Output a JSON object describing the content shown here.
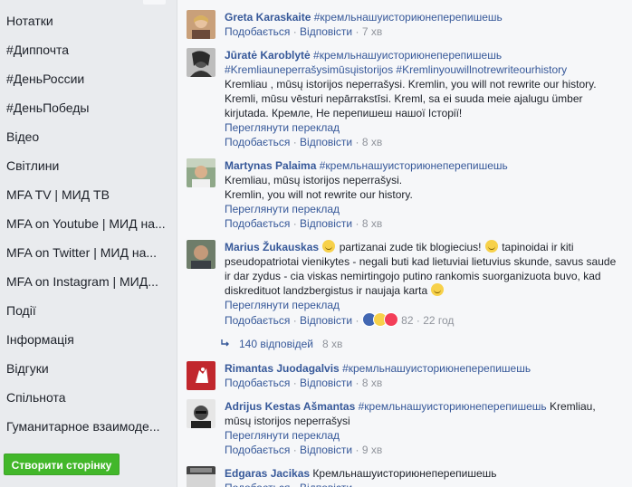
{
  "sidebar": {
    "items": [
      "Нотатки",
      "#Диппочта",
      "#ДеньРоссии",
      "#ДеньПобеды",
      "Відео",
      "Світлини",
      "MFA TV | МИД ТВ",
      "MFA on Youtube | МИД на...",
      "MFA on Twitter | МИД на...",
      "MFA on Instagram | МИД...",
      "Події",
      "Інформація",
      "Відгуки",
      "Спільнота",
      "Гуманитарное взаимоде..."
    ],
    "create_button": "Створити сторінку"
  },
  "actions": {
    "like": "Подобається",
    "reply": "Відповісти",
    "sep": "·",
    "translate": "Переглянути переклад"
  },
  "comments": [
    {
      "author": "Greta Karaskaite",
      "hashtag": "#кремльнашуисториюнеперепишешь",
      "time": "7 хв"
    },
    {
      "author": "Jūratė Karoblytė",
      "hashtag": "#кремльнашуисториюнеперепишешь",
      "hashtags_line2": "#Kremliauneperrašysimūsųistorijos #Kremlinyouwillnotrewriteourhistory",
      "text": "Kremliau , mūsų istorijos neperrašysi. Kremlin, you will not rewrite our history. Kremli, mūsu vēsturi nepārrakstīsi. Kreml, sa ei suuda meie ajalugu ümber kirjutada. Кремле, Не перепишеш нашої Історії!",
      "time": "8 хв"
    },
    {
      "author": "Martynas Palaima",
      "hashtag": "#кремльнашуисториюнеперепишешь",
      "line1": "Kremliau, mūsų istorijos neperrašysi.",
      "line2": "Kremlin, you will not rewrite our history.",
      "time": "8 хв"
    },
    {
      "author": "Marius Žukauskas",
      "text_a": "partizanai zude tik blogiecius!",
      "text_b": "tapinoidai ir kiti pseudopatriotai vienikytes - negali buti kad lietuviai lietuvius skunde, savus saude ir dar zydus - cia viskas nemirtingojo putino rankomis suorganizuota buvo, kad diskredituot landzbergistus ir naujaja karta",
      "reactions_count": "82",
      "time": "22 год",
      "replies_label": "140 відповідей",
      "replies_time": "8 хв"
    },
    {
      "author": "Rimantas Juodagalvis",
      "hashtag": "#кремльнашуисториюнеперепишешь",
      "time": "8 хв"
    },
    {
      "author": "Adrijus Kestas Ašmantas",
      "hashtag": "#кремльнашуисториюнеперепишешь",
      "text": "Kremliau, mūsų istorijos neperrašysi",
      "time": "9 хв"
    },
    {
      "author": "Edgaras Jacikas",
      "text": "Кремльнашуисториюнеперепишешь"
    }
  ],
  "colors": {
    "link": "#365899",
    "meta": "#90949c",
    "create_button": "#42b72a",
    "feed_bg": "#f6f7f9",
    "sidebar_bg": "#e9ebee"
  }
}
